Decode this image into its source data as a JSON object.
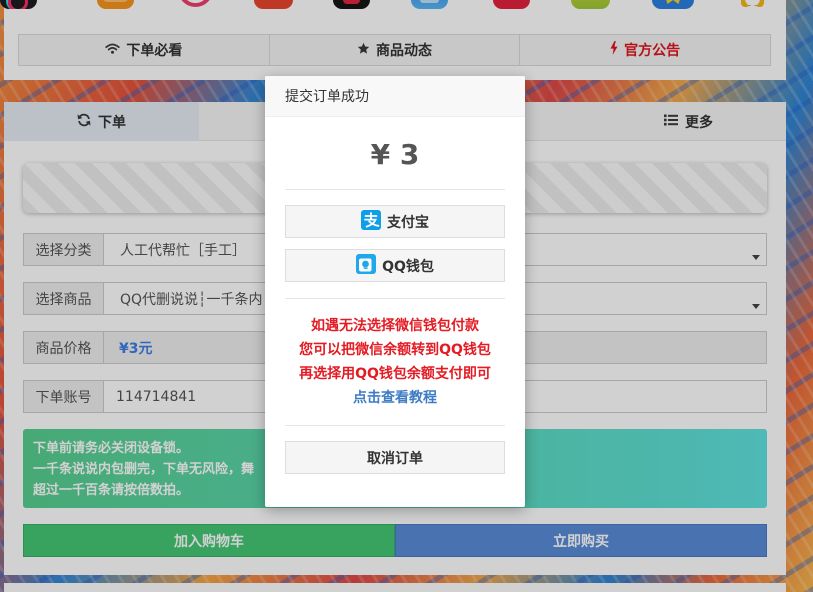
{
  "top_apps": [
    "tiktok-icon",
    "orange-app-icon",
    "pink-circle-app-icon",
    "red-app-icon",
    "black-red-app-icon",
    "blue-app-icon",
    "red-square-app-icon",
    "yellow-app-icon",
    "star-app-icon",
    "qq-penguin-icon"
  ],
  "notice_tabs": [
    {
      "label": "下单必看",
      "icon": "wifi-icon"
    },
    {
      "label": "商品动态",
      "icon": "star-icon"
    },
    {
      "label": "官方公告",
      "icon": "bolt-icon",
      "color": "#e0141e"
    }
  ],
  "order_tabs": [
    {
      "label": "下单",
      "icon": "refresh-icon",
      "active": true
    },
    {
      "label": "更多",
      "icon": "list-icon",
      "active": false
    }
  ],
  "form": {
    "category": {
      "label": "选择分类",
      "value": "人工代帮忙［手工］"
    },
    "product": {
      "label": "选择商品",
      "value": "QQ代删说说┆一千条内"
    },
    "price": {
      "label": "商品价格",
      "value": "¥3元"
    },
    "account": {
      "label": "下单账号",
      "value": "114714841"
    }
  },
  "notice": {
    "lines": [
      "下单前请务必关闭设备锁。",
      "一千条说说内包删完，下单无风险，舞",
      "超过一千百条请按倍数拍。"
    ]
  },
  "actions": {
    "add_to_cart": "加入购物车",
    "buy_now": "立即购买"
  },
  "modal": {
    "title": "提交订单成功",
    "amount": "¥ 3",
    "pay_alipay": "支付宝",
    "pay_qq": "QQ钱包",
    "tips": [
      "如遇无法选择微信钱包付款",
      "您可以把微信余额转到QQ钱包",
      "再选择用QQ钱包余额支付即可"
    ],
    "tutorial_link": "点击查看教程",
    "cancel": "取消订单"
  },
  "colors": {
    "tip_red": "#e41b23",
    "link_blue": "#3f7cc4",
    "price_blue": "#3c7ee8",
    "cart_green": "#44c774",
    "buy_blue": "#5a8dd7",
    "notice_from": "#57cf8f",
    "notice_to": "#60e2de"
  }
}
